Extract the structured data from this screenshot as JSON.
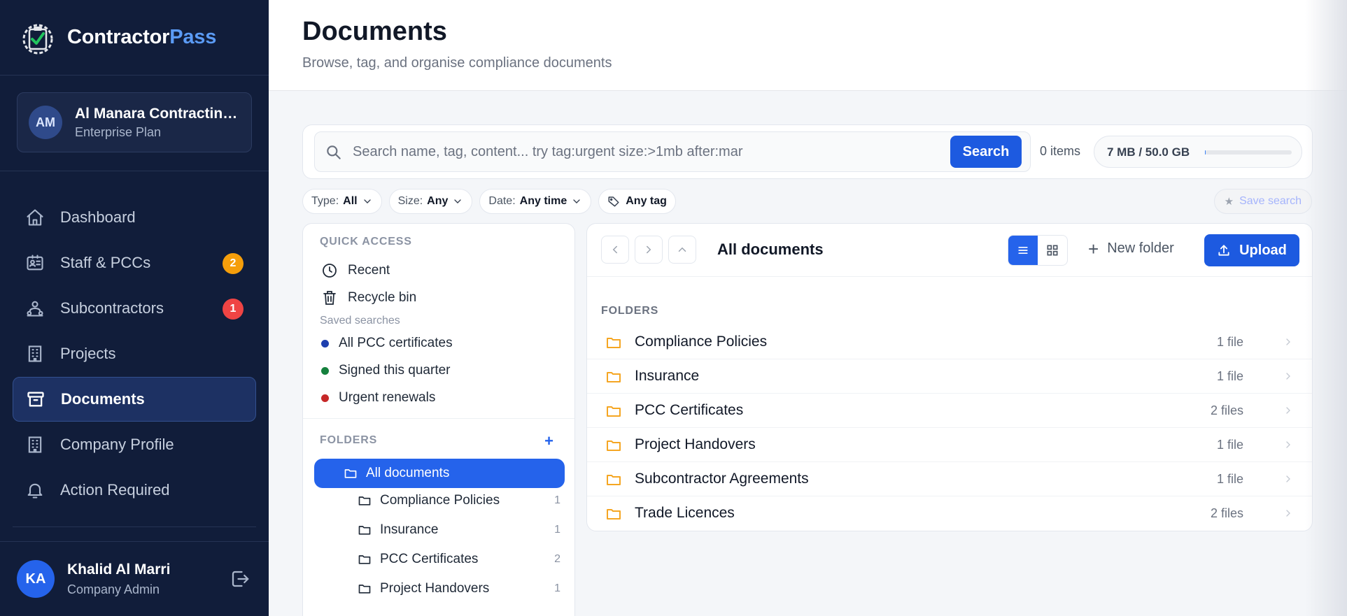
{
  "brand": {
    "name_main": "Contractor",
    "name_accent": "Pass"
  },
  "company": {
    "initials": "AM",
    "name": "Al Manara Contracting LLC",
    "plan": "Enterprise Plan"
  },
  "nav": [
    {
      "label": "Dashboard",
      "icon": "home-icon",
      "badge": null
    },
    {
      "label": "Staff & PCCs",
      "icon": "id-card-icon",
      "badge": "2"
    },
    {
      "label": "Subcontractors",
      "icon": "users-icon",
      "badge": "1"
    },
    {
      "label": "Projects",
      "icon": "building-icon",
      "badge": null
    },
    {
      "label": "Documents",
      "icon": "archive-icon",
      "badge": null,
      "active": true
    },
    {
      "label": "Company Profile",
      "icon": "building-icon",
      "badge": null
    },
    {
      "label": "Action Required",
      "icon": "bell-icon",
      "badge": null
    }
  ],
  "user": {
    "initials": "KA",
    "name": "Khalid Al Marri",
    "role": "Company Admin"
  },
  "header": {
    "title": "Documents",
    "subtitle": "Browse, tag, and organise compliance documents"
  },
  "search": {
    "placeholder": "Search name, tag, content... try tag:urgent size:>1mb after:mar",
    "value": "",
    "button": "Search",
    "items_count": "0 items",
    "storage_label": "7 MB / 50.0 GB",
    "storage_fraction": 0.0001
  },
  "filters": {
    "type_label": "Type:",
    "type_value": "All",
    "size_label": "Size:",
    "size_value": "Any",
    "date_label": "Date:",
    "date_value": "Any time",
    "tag_value": "Any tag",
    "save_search": "Save search"
  },
  "quick_access": {
    "title": "QUICK ACCESS",
    "recent": "Recent",
    "recycle": "Recycle bin",
    "saved_label": "Saved searches",
    "saved": [
      {
        "label": "All PCC certificates",
        "color": "#1e40af"
      },
      {
        "label": "Signed this quarter",
        "color": "#15803d"
      },
      {
        "label": "Urgent renewals",
        "color": "#c62828"
      }
    ]
  },
  "tree": {
    "title": "FOLDERS",
    "add": "+",
    "active": "All documents",
    "items": [
      {
        "label": "Compliance Policies",
        "count": "1"
      },
      {
        "label": "Insurance",
        "count": "1"
      },
      {
        "label": "PCC Certificates",
        "count": "2"
      },
      {
        "label": "Project Handovers",
        "count": "1"
      }
    ]
  },
  "explorer": {
    "path": "All documents",
    "new_folder": "New folder",
    "upload": "Upload",
    "folders_label": "FOLDERS",
    "folders": [
      {
        "name": "Compliance Policies",
        "count": "1 file"
      },
      {
        "name": "Insurance",
        "count": "1 file"
      },
      {
        "name": "PCC Certificates",
        "count": "2 files"
      },
      {
        "name": "Project Handovers",
        "count": "1 file"
      },
      {
        "name": "Subcontractor Agreements",
        "count": "1 file"
      },
      {
        "name": "Trade Licences",
        "count": "2 files"
      }
    ]
  },
  "colors": {
    "primary": "#1d5ae0",
    "sidebar": "#111d3a",
    "folder": "#f5a623"
  }
}
